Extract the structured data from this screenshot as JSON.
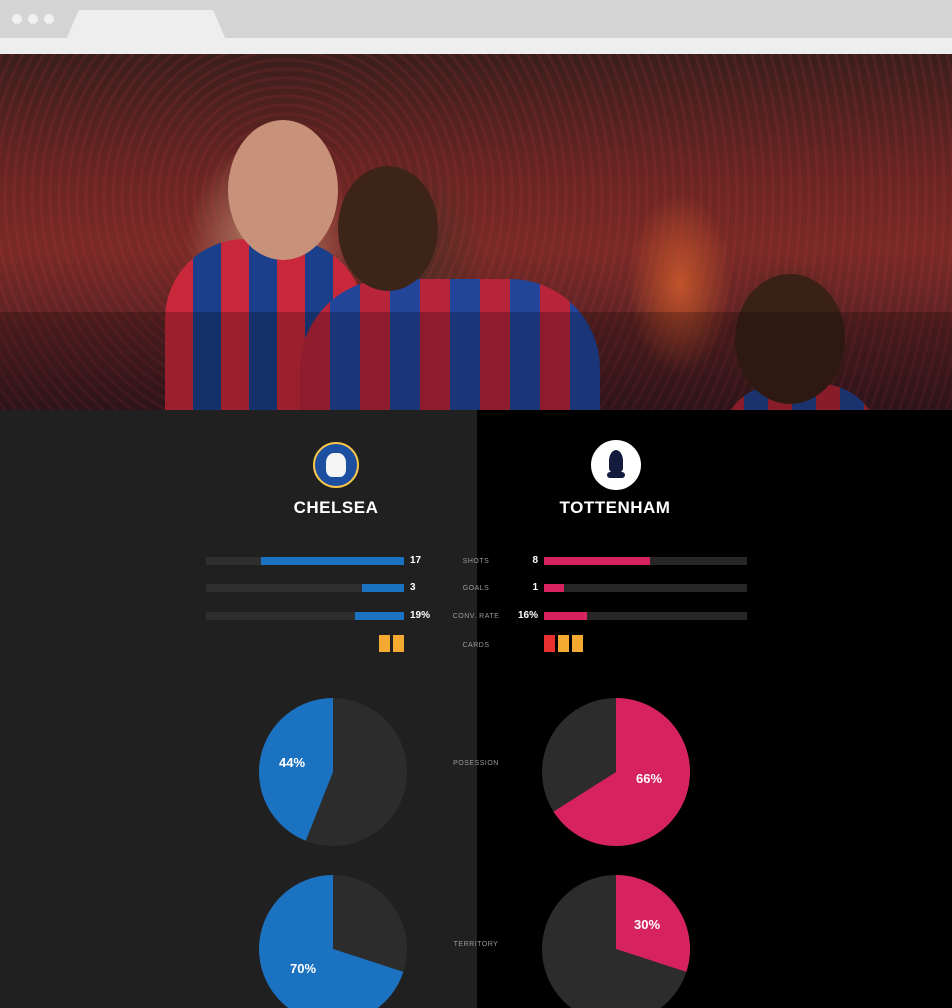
{
  "colors": {
    "chelsea": "#1b72c0",
    "tottenham": "#d6235f",
    "yellow_card": "#f4a931",
    "red_card": "#e8312f",
    "pie_base": "#2c2c2c"
  },
  "hero": {
    "image": "celebrating-players-photo"
  },
  "teams": {
    "left": {
      "name": "CHELSEA",
      "crest": "chelsea-crest-icon"
    },
    "right": {
      "name": "TOTTENHAM",
      "crest": "tottenham-crest-icon"
    }
  },
  "stats": [
    {
      "label": "SHOTS",
      "left": "17",
      "right": "8",
      "left_fraction": 0.72,
      "right_fraction": 0.52
    },
    {
      "label": "GOALS",
      "left": "3",
      "right": "1",
      "left_fraction": 0.21,
      "right_fraction": 0.1
    },
    {
      "label": "CONV. RATE",
      "left": "19%",
      "right": "16%",
      "left_fraction": 0.25,
      "right_fraction": 0.21
    }
  ],
  "cards": {
    "label": "CARDS",
    "left": [
      "yellow",
      "yellow"
    ],
    "right": [
      "red",
      "yellow",
      "yellow"
    ]
  },
  "chart_data": [
    {
      "type": "pie",
      "label": "POSESSION",
      "left": {
        "label": "44%",
        "value": 44
      },
      "right": {
        "label": "66%",
        "value": 66
      }
    },
    {
      "type": "pie",
      "label": "TERRITORY",
      "left": {
        "label": "70%",
        "value": 70
      },
      "right": {
        "label": "30%",
        "value": 30
      }
    }
  ]
}
